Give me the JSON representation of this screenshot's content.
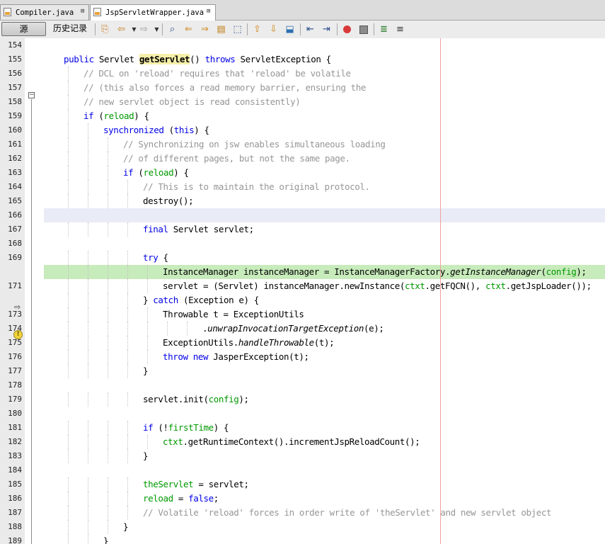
{
  "tabs": [
    {
      "label": "Compiler.java",
      "close": "⊠"
    },
    {
      "label": "JspServletWrapper.java",
      "close": "⊠"
    }
  ],
  "toolbar": {
    "source_label": "源",
    "history_label": "历史记录"
  },
  "gutter_icons": [
    "fold-minus-icon",
    "current-line-arrow-icon",
    "warning-bulb-icon"
  ],
  "colors": {
    "keyword": "#0000e6",
    "comment": "#969696",
    "field": "#009900",
    "current_line": "#c7ebbb",
    "caret_line": "#e9ecf6",
    "method_highlight": "#f5f0a8",
    "right_margin": "#f0a0a0"
  },
  "editor": {
    "lines": [
      {
        "n": "154",
        "indent": 0,
        "t": [
          {
            "s": ""
          }
        ]
      },
      {
        "n": "155",
        "indent": 1,
        "t": [
          {
            "s": "public",
            "c": "kw"
          },
          {
            "s": " Servlet "
          },
          {
            "s": "getServlet",
            "c": "mhl"
          },
          {
            "s": "() "
          },
          {
            "s": "throws",
            "c": "kw"
          },
          {
            "s": " ServletException {"
          }
        ]
      },
      {
        "n": "156",
        "indent": 2,
        "t": [
          {
            "s": "// DCL on 'reload' requires that 'reload' be volatile",
            "c": "cm"
          }
        ]
      },
      {
        "n": "157",
        "indent": 2,
        "t": [
          {
            "s": "// (this also forces a read memory barrier, ensuring the",
            "c": "cm"
          }
        ]
      },
      {
        "n": "158",
        "indent": 2,
        "t": [
          {
            "s": "// new servlet object is read consistently)",
            "c": "cm"
          }
        ]
      },
      {
        "n": "159",
        "indent": 2,
        "t": [
          {
            "s": "if",
            "c": "kw"
          },
          {
            "s": " ("
          },
          {
            "s": "reload",
            "c": "fld"
          },
          {
            "s": ") {"
          }
        ]
      },
      {
        "n": "160",
        "indent": 3,
        "t": [
          {
            "s": "synchronized",
            "c": "kw"
          },
          {
            "s": " ("
          },
          {
            "s": "this",
            "c": "kw"
          },
          {
            "s": ") {"
          }
        ]
      },
      {
        "n": "161",
        "indent": 4,
        "t": [
          {
            "s": "// Synchronizing on jsw enables simultaneous loading",
            "c": "cm"
          }
        ]
      },
      {
        "n": "162",
        "indent": 4,
        "t": [
          {
            "s": "// of different pages, but not the same page.",
            "c": "cm"
          }
        ]
      },
      {
        "n": "163",
        "indent": 4,
        "t": [
          {
            "s": "if",
            "c": "kw"
          },
          {
            "s": " ("
          },
          {
            "s": "reload",
            "c": "fld"
          },
          {
            "s": ") {"
          }
        ]
      },
      {
        "n": "164",
        "indent": 5,
        "t": [
          {
            "s": "// This is to maintain the original protocol.",
            "c": "cm"
          }
        ]
      },
      {
        "n": "165",
        "indent": 5,
        "t": [
          {
            "s": "destroy();"
          }
        ]
      },
      {
        "n": "166",
        "indent": 0,
        "hl": "gray",
        "t": [
          {
            "s": ""
          }
        ]
      },
      {
        "n": "167",
        "indent": 5,
        "t": [
          {
            "s": "final",
            "c": "kw"
          },
          {
            "s": " Servlet servlet;"
          }
        ]
      },
      {
        "n": "168",
        "indent": 0,
        "t": [
          {
            "s": ""
          }
        ]
      },
      {
        "n": "169",
        "indent": 5,
        "t": [
          {
            "s": "try",
            "c": "kw"
          },
          {
            "s": " {"
          }
        ]
      },
      {
        "n": "",
        "indent": 6,
        "hl": "green",
        "t": [
          {
            "s": "InstanceManager instanceManager = InstanceManagerFactory."
          },
          {
            "s": "getInstanceManager",
            "c": "it"
          },
          {
            "s": "("
          },
          {
            "s": "config",
            "c": "fld"
          },
          {
            "s": ");"
          }
        ]
      },
      {
        "n": "171",
        "indent": 6,
        "t": [
          {
            "s": "servlet = (Servlet) instanceManager.newInstance("
          },
          {
            "s": "ctxt",
            "c": "fld"
          },
          {
            "s": ".getFQCN(), "
          },
          {
            "s": "ctxt",
            "c": "fld"
          },
          {
            "s": ".getJspLoader());"
          }
        ]
      },
      {
        "n": "",
        "indent": 5,
        "t": [
          {
            "s": "} "
          },
          {
            "s": "catch",
            "c": "kw"
          },
          {
            "s": " (Exception e) {"
          }
        ]
      },
      {
        "n": "173",
        "indent": 6,
        "t": [
          {
            "s": "Throwable t = ExceptionUtils"
          }
        ]
      },
      {
        "n": "174",
        "indent": 8,
        "t": [
          {
            "s": "."
          },
          {
            "s": "unwrapInvocationTargetException",
            "c": "it"
          },
          {
            "s": "(e);"
          }
        ]
      },
      {
        "n": "175",
        "indent": 6,
        "t": [
          {
            "s": "ExceptionUtils."
          },
          {
            "s": "handleThrowable",
            "c": "it"
          },
          {
            "s": "(t);"
          }
        ]
      },
      {
        "n": "176",
        "indent": 6,
        "t": [
          {
            "s": "throw",
            "c": "kw"
          },
          {
            "s": " "
          },
          {
            "s": "new",
            "c": "kw"
          },
          {
            "s": " JasperException(t);"
          }
        ]
      },
      {
        "n": "177",
        "indent": 5,
        "t": [
          {
            "s": "}"
          }
        ]
      },
      {
        "n": "178",
        "indent": 0,
        "t": [
          {
            "s": ""
          }
        ]
      },
      {
        "n": "179",
        "indent": 5,
        "t": [
          {
            "s": "servlet.init("
          },
          {
            "s": "config",
            "c": "fld"
          },
          {
            "s": ");"
          }
        ]
      },
      {
        "n": "180",
        "indent": 0,
        "t": [
          {
            "s": ""
          }
        ]
      },
      {
        "n": "181",
        "indent": 5,
        "t": [
          {
            "s": "if",
            "c": "kw"
          },
          {
            "s": " (!"
          },
          {
            "s": "firstTime",
            "c": "fld"
          },
          {
            "s": ") {"
          }
        ]
      },
      {
        "n": "182",
        "indent": 6,
        "t": [
          {
            "s": "ctxt",
            "c": "fld"
          },
          {
            "s": ".getRuntimeContext().incrementJspReloadCount();"
          }
        ]
      },
      {
        "n": "183",
        "indent": 5,
        "t": [
          {
            "s": "}"
          }
        ]
      },
      {
        "n": "184",
        "indent": 0,
        "t": [
          {
            "s": ""
          }
        ]
      },
      {
        "n": "185",
        "indent": 5,
        "t": [
          {
            "s": "theServlet",
            "c": "fld"
          },
          {
            "s": " = servlet;"
          }
        ]
      },
      {
        "n": "186",
        "indent": 5,
        "t": [
          {
            "s": "reload",
            "c": "fld"
          },
          {
            "s": " = "
          },
          {
            "s": "false",
            "c": "kw"
          },
          {
            "s": ";"
          }
        ]
      },
      {
        "n": "187",
        "indent": 5,
        "t": [
          {
            "s": "// Volatile 'reload' forces in order write of 'theServlet' and new servlet object",
            "c": "cm"
          }
        ]
      },
      {
        "n": "188",
        "indent": 4,
        "t": [
          {
            "s": "}"
          }
        ]
      },
      {
        "n": "189",
        "indent": 3,
        "t": [
          {
            "s": "}"
          }
        ]
      }
    ]
  }
}
